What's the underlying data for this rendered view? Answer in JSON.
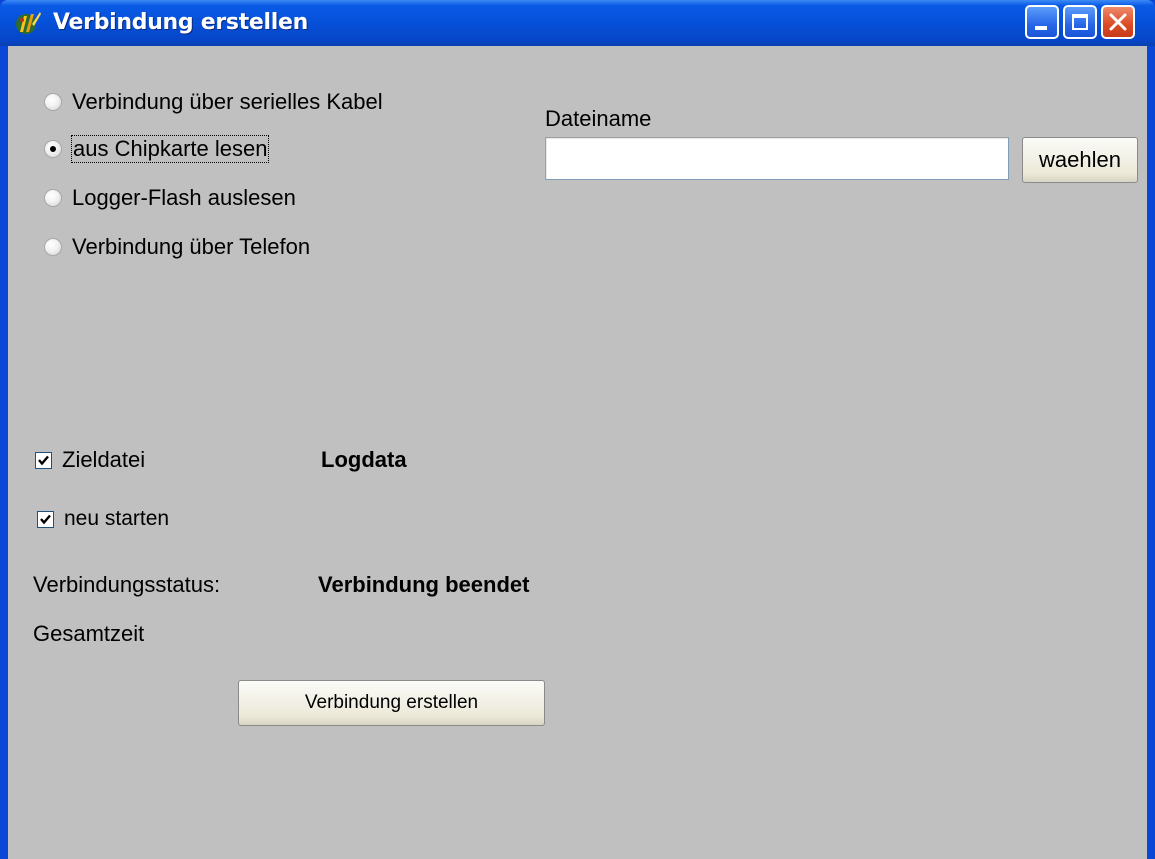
{
  "window": {
    "title": "Verbindung erstellen",
    "icon": "app-logo-icon",
    "controls": [
      "minimize-icon",
      "maximize-icon",
      "close-icon"
    ]
  },
  "source_options": [
    {
      "label": "Verbindung über serielles Kabel",
      "selected": false
    },
    {
      "label": "aus Chipkarte lesen",
      "selected": true
    },
    {
      "label": "Logger-Flash auslesen",
      "selected": false
    },
    {
      "label": "Verbindung über Telefon",
      "selected": false
    }
  ],
  "file": {
    "label": "Dateiname",
    "value": "",
    "choose_label": "waehlen"
  },
  "target_file": {
    "label": "Zieldatei",
    "checked": true,
    "value": "Logdata"
  },
  "restart": {
    "label": "neu starten",
    "checked": true
  },
  "status": {
    "label": "Verbindungsstatus:",
    "value": "Verbindung beendet"
  },
  "total_time": {
    "label": "Gesamtzeit"
  },
  "connect_button": {
    "label": "Verbindung erstellen"
  },
  "colors": {
    "titlebar": "#0650d8",
    "window_bg": "#c0c0c0",
    "close_button": "#db4a25"
  }
}
